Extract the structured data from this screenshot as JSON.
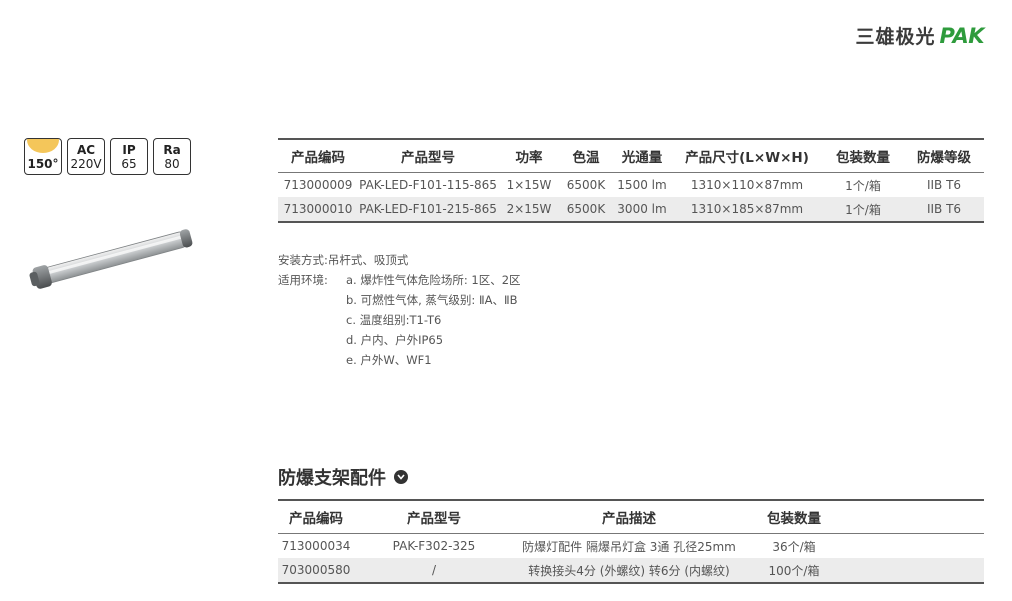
{
  "brand": {
    "name_cn": "三雄极光",
    "name_en": "PAK",
    "color": "#2e9b3c"
  },
  "badges": [
    {
      "top": "",
      "bottom": "150°"
    },
    {
      "top": "AC",
      "bottom": "220V"
    },
    {
      "top": "IP",
      "bottom": "65"
    },
    {
      "top": "Ra",
      "bottom": "80"
    }
  ],
  "products": {
    "headers": [
      "产品编码",
      "产品型号",
      "功率",
      "色温",
      "光通量",
      "产品尺寸(L×W×H)",
      "包装数量",
      "防爆等级"
    ],
    "rows": [
      [
        "713000009",
        "PAK-LED-F101-115-865",
        "1×15W",
        "6500K",
        "1500 lm",
        "1310×110×87mm",
        "1个/箱",
        "IIB T6"
      ],
      [
        "713000010",
        "PAK-LED-F101-215-865",
        "2×15W",
        "6500K",
        "3000 lm",
        "1310×185×87mm",
        "1个/箱",
        "IIB T6"
      ]
    ]
  },
  "install": {
    "mount_label": "安装方式:",
    "mount_value": "吊杆式、吸顶式",
    "env_label": "适用环境:",
    "env_items": [
      "a. 爆炸性气体危险场所: 1区、2区",
      "b. 可燃性气体, 蒸气级别: ⅡA、ⅡB",
      "c. 温度组别:T1-T6",
      "d. 户内、户外IP65",
      "e. 户外W、WF1"
    ]
  },
  "accessories": {
    "title": "防爆支架配件",
    "headers": [
      "产品编码",
      "产品型号",
      "产品描述",
      "包装数量"
    ],
    "rows": [
      [
        "713000034",
        "PAK-F302-325",
        "防爆灯配件 隔爆吊灯盒 3通 孔径25mm",
        "36个/箱"
      ],
      [
        "703000580",
        "/",
        "转换接头4分 (外螺纹) 转6分 (内螺纹)",
        "100个/箱"
      ]
    ]
  }
}
